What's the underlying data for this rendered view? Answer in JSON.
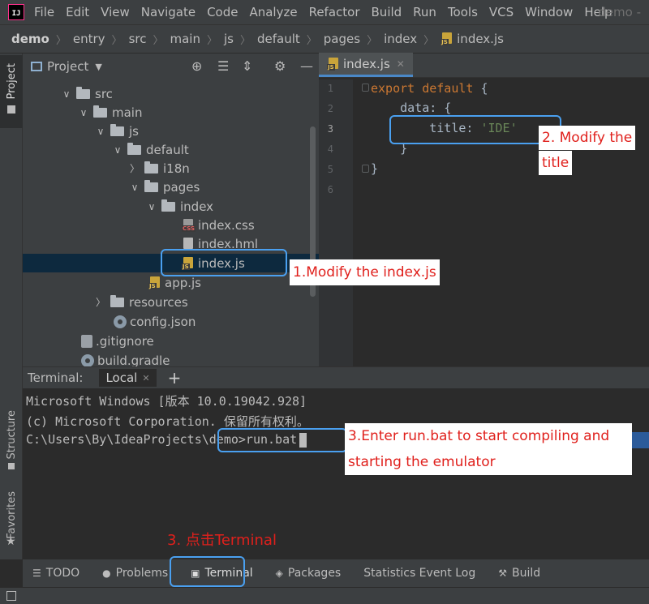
{
  "menubar": {
    "logo_text": "IJ",
    "items": [
      "File",
      "Edit",
      "View",
      "Navigate",
      "Code",
      "Analyze",
      "Refactor",
      "Build",
      "Run",
      "Tools",
      "VCS",
      "Window",
      "Help"
    ],
    "window_title": "demo -"
  },
  "breadcrumb": [
    "demo",
    "entry",
    "src",
    "main",
    "js",
    "default",
    "pages",
    "index",
    "index.js"
  ],
  "left_stripe": {
    "project": "Project",
    "structure": "Structure",
    "favorites": "Favorites"
  },
  "project_panel": {
    "title": "Project",
    "tree": [
      {
        "label": "src",
        "type": "folder",
        "expanded": true
      },
      {
        "label": "main",
        "type": "folder",
        "expanded": true
      },
      {
        "label": "js",
        "type": "folder",
        "expanded": true
      },
      {
        "label": "default",
        "type": "folder",
        "expanded": true
      },
      {
        "label": "i18n",
        "type": "folder",
        "expanded": false
      },
      {
        "label": "pages",
        "type": "folder",
        "expanded": true
      },
      {
        "label": "index",
        "type": "folder",
        "expanded": true
      },
      {
        "label": "index.css",
        "type": "css"
      },
      {
        "label": "index.hml",
        "type": "html"
      },
      {
        "label": "index.js",
        "type": "js",
        "selected": true
      },
      {
        "label": "app.js",
        "type": "js"
      },
      {
        "label": "resources",
        "type": "folder",
        "expanded": false
      },
      {
        "label": "config.json",
        "type": "json"
      },
      {
        "label": ".gitignore",
        "type": "git"
      },
      {
        "label": "build.gradle",
        "type": "gradle"
      }
    ]
  },
  "editor": {
    "tab_label": "index.js",
    "tab_badge": "JS",
    "line_numbers": [
      "1",
      "2",
      "3",
      "4",
      "5",
      "6"
    ],
    "code": {
      "l1_kw1": "export",
      "l1_kw2": "default",
      "l1_rest": " {",
      "l2": "    data: {",
      "l3_key": "        title: ",
      "l3_val": "'IDE'",
      "l4": "    }",
      "l5": "}"
    }
  },
  "terminal": {
    "label": "Terminal:",
    "tab": "Local",
    "lines": [
      "Microsoft Windows [版本 10.0.19042.928]",
      "(c) Microsoft Corporation. 保留所有权利。",
      "C:\\Users\\By\\IdeaProjects\\demo>run.bat"
    ]
  },
  "bottom_bar": [
    "TODO",
    "Problems",
    "Terminal",
    "Packages",
    "Statistics Event Log",
    "Build"
  ],
  "annotations": {
    "step1": "1.Modify the index.js",
    "step2_line1": "2. Modify the",
    "step2_line2": "title",
    "step3_enter_line1": "3.Enter run.bat to start compiling and",
    "step3_enter_line2": "starting the emulator",
    "step3_click": "3. 点击Terminal"
  },
  "colors": {
    "highlight_box": "#4aa0f0",
    "annotation_text": "#e0201c",
    "selection": "#0d293e"
  }
}
